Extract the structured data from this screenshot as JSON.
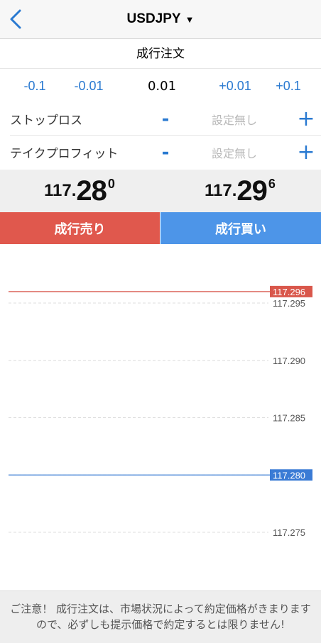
{
  "header": {
    "symbol": "USDJPY",
    "caret": "▼",
    "back_icon": "chevron-left-icon"
  },
  "order_type": "成行注文",
  "lot": {
    "dec_large": "-0.1",
    "dec_small": "-0.01",
    "value": "0.01",
    "inc_small": "+0.01",
    "inc_large": "+0.1"
  },
  "stop_loss": {
    "label": "ストップロス",
    "minus": "-",
    "value": "設定無し",
    "plus": "+"
  },
  "take_profit": {
    "label": "テイクプロフィット",
    "minus": "-",
    "value": "設定無し",
    "plus": "+"
  },
  "prices": {
    "bid": {
      "prefix": "117.",
      "big": "28",
      "sup": "0"
    },
    "ask": {
      "prefix": "117.",
      "big": "29",
      "sup": "6"
    }
  },
  "buttons": {
    "sell": "成行売り",
    "buy": "成行買い"
  },
  "chart": {
    "levels": [
      {
        "value": 117.295,
        "label": "117.295"
      },
      {
        "value": 117.29,
        "label": "117.290"
      },
      {
        "value": 117.285,
        "label": "117.285"
      },
      {
        "value": 117.28,
        "label": "117.280"
      },
      {
        "value": 117.275,
        "label": "117.275"
      }
    ],
    "bid_line": {
      "value": 117.28,
      "label": "117.280",
      "color": "#3a7bd5"
    },
    "ask_line": {
      "value": 117.296,
      "label": "117.296",
      "color": "#d9574b"
    }
  },
  "notice": "ご注意！ 成行注文は、市場状況によって約定価格がきまりますので、必ずしも提示価格で約定するとは限りません!"
}
